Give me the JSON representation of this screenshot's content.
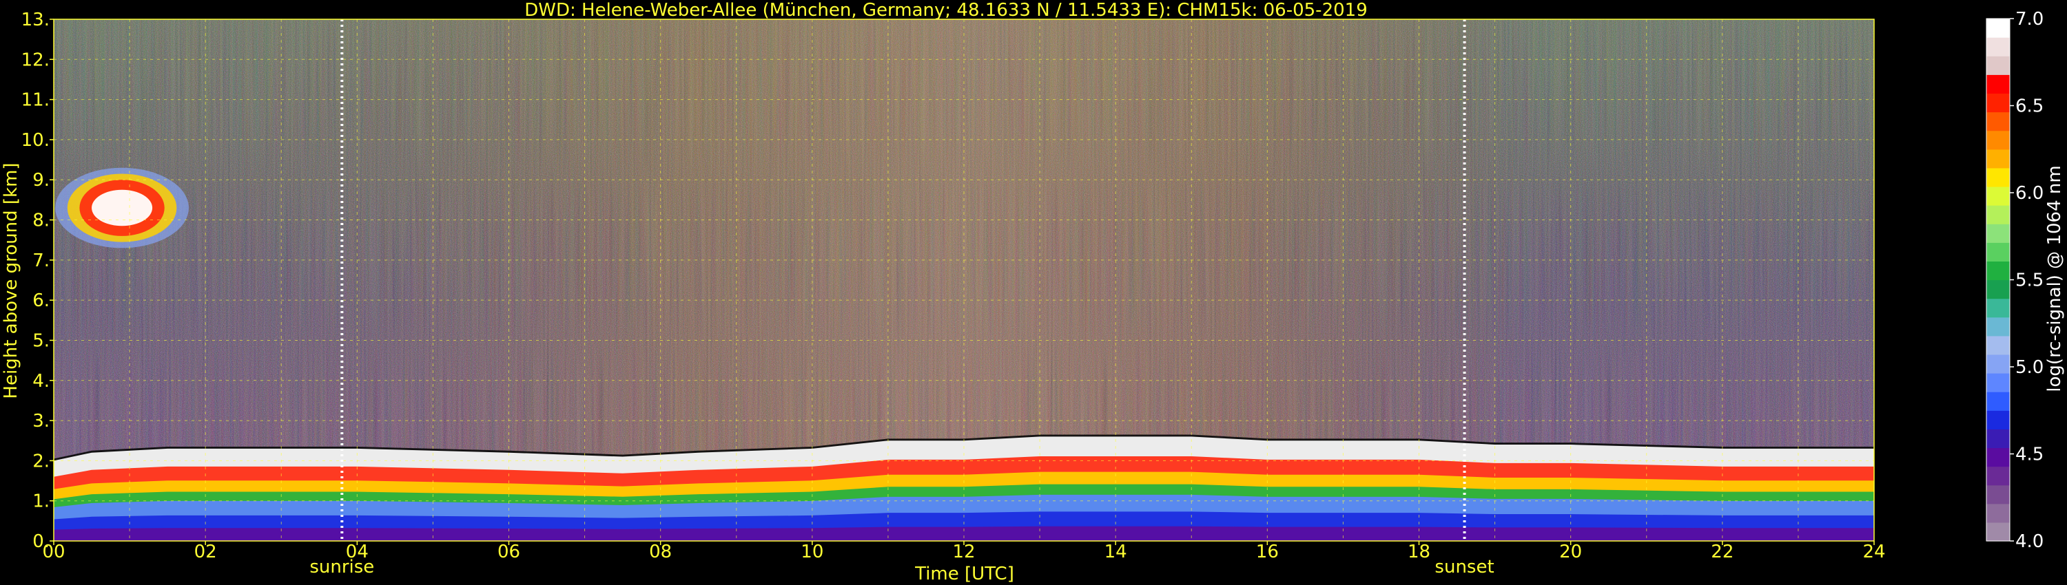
{
  "chart_data": {
    "type": "heatmap",
    "title": "DWD: Helene-Weber-Allee (München, Germany; 48.1633 N / 11.5433 E):    CHM15k: 06-05-2019",
    "xlabel": "Time [UTC]",
    "ylabel": "Height above ground [km]",
    "xlim": [
      0,
      24
    ],
    "ylim": [
      0,
      13
    ],
    "x_ticks": [
      "00",
      "02",
      "04",
      "06",
      "08",
      "10",
      "12",
      "14",
      "16",
      "18",
      "20",
      "22",
      "24"
    ],
    "y_ticks": [
      "0.",
      "1.",
      "2.",
      "3.",
      "4.",
      "5.",
      "6.",
      "7.",
      "8.",
      "9.",
      "10.",
      "11.",
      "12.",
      "13."
    ],
    "grid": true,
    "annotations": [
      {
        "label": "sunrise",
        "x": 3.8
      },
      {
        "label": "sunset",
        "x": 18.6
      }
    ],
    "colorbar": {
      "label": "log(rc-signal) @ 1064 nm",
      "range": [
        4.0,
        7.0
      ],
      "ticks": [
        "4.0",
        "4.5",
        "5.0",
        "5.5",
        "6.0",
        "6.5",
        "7.0"
      ],
      "colors": [
        "#a08aa8",
        "#8e6c9c",
        "#7a4c92",
        "#6a2a96",
        "#5a0ca0",
        "#3a1cb4",
        "#1a2ae0",
        "#2f5cff",
        "#5e86ff",
        "#86a4f4",
        "#a4bcee",
        "#6ab8d4",
        "#3ab898",
        "#18a050",
        "#20b040",
        "#5ad060",
        "#8ce27a",
        "#b4f05a",
        "#dcfa36",
        "#ffe600",
        "#ffb000",
        "#ff8a00",
        "#ff5a00",
        "#ff2200",
        "#ff0000",
        "#e0c8c8",
        "#f0e0e0",
        "#ffffff"
      ]
    },
    "series": [
      {
        "values": [
          [
            0,
            2.0
          ],
          [
            0.5,
            2.2
          ],
          [
            1.5,
            2.3
          ],
          [
            3.0,
            2.3
          ],
          [
            4.0,
            2.3
          ],
          [
            6.0,
            2.2
          ],
          [
            7.5,
            2.1
          ],
          [
            8.5,
            2.2
          ],
          [
            10,
            2.3
          ],
          [
            11,
            2.5
          ],
          [
            12,
            2.5
          ],
          [
            13,
            2.6
          ],
          [
            14,
            2.6
          ],
          [
            15,
            2.6
          ],
          [
            16,
            2.5
          ],
          [
            17,
            2.5
          ],
          [
            18,
            2.5
          ],
          [
            19,
            2.4
          ],
          [
            20,
            2.4
          ],
          [
            22,
            2.3
          ],
          [
            24,
            2.3
          ]
        ]
      }
    ]
  }
}
